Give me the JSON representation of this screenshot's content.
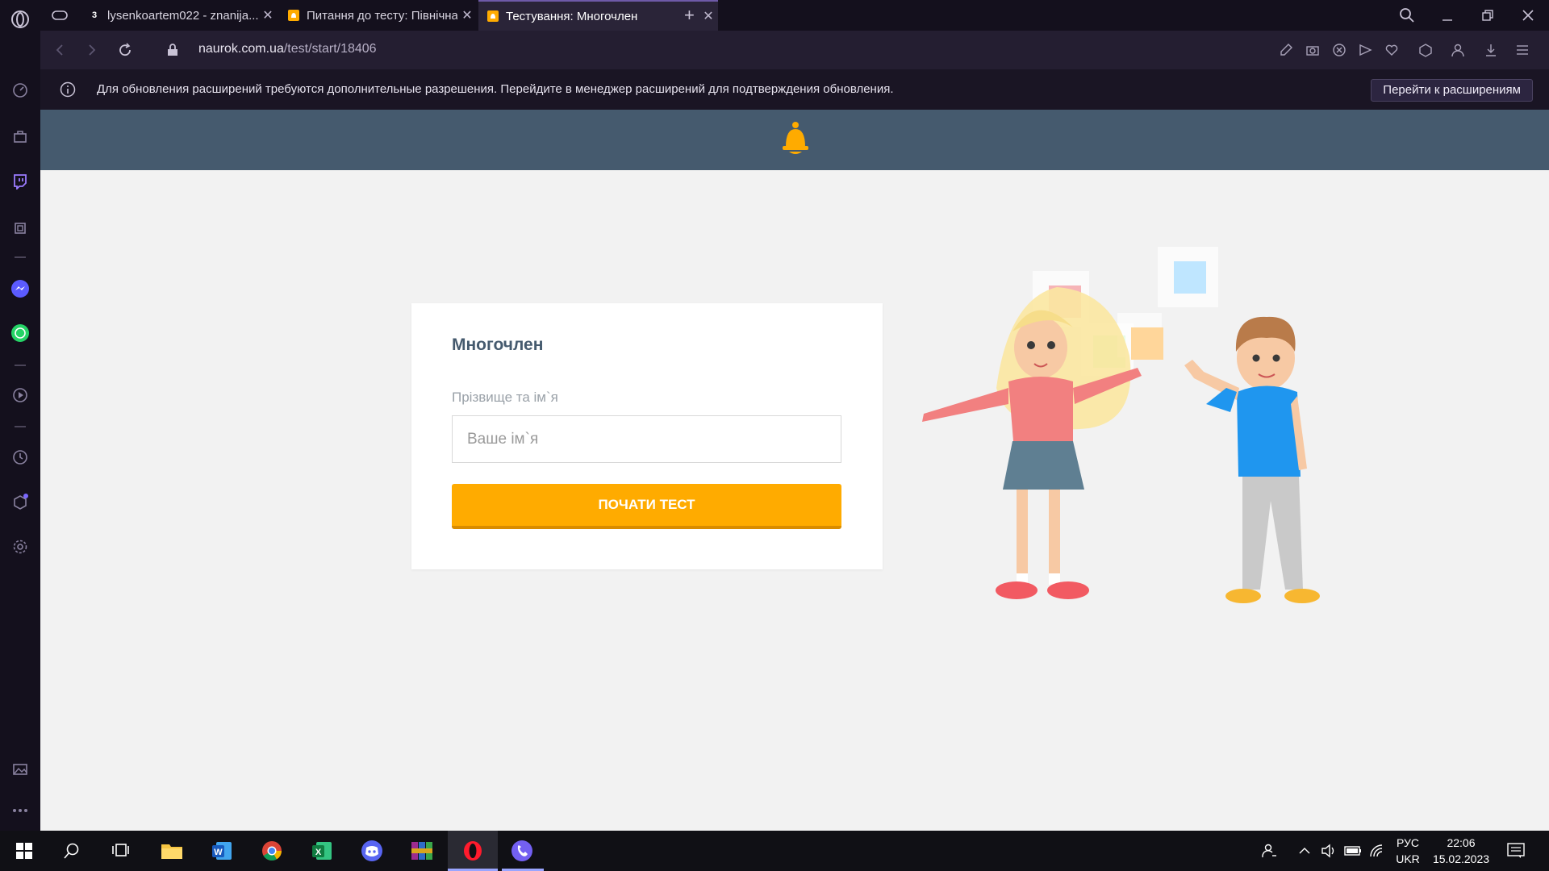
{
  "browser": {
    "tabs": [
      {
        "title": "lysenkoartem022 - znanija...",
        "favicon": "3"
      },
      {
        "title": "Питання до тесту: Північна...",
        "favicon": "bell"
      },
      {
        "title": "Тестування: Многочлен",
        "favicon": "bell"
      }
    ],
    "url_host": "naurok.com.ua",
    "url_path": "/test/start/18406"
  },
  "notification": {
    "text": "Для обновления расширений требуются дополнительные разрешения. Перейдите в менеджер расширений для подтверждения обновления.",
    "button": "Перейти к расширениям"
  },
  "test": {
    "title": "Многочлен",
    "name_label": "Прізвище та ім`я",
    "name_placeholder": "Ваше ім`я",
    "start_button": "ПОЧАТИ ТЕСТ"
  },
  "taskbar": {
    "lang_top": "РУС",
    "lang_bottom": "UKR",
    "time": "22:06",
    "date": "15.02.2023"
  },
  "colors": {
    "header": "#455a6e",
    "accent": "#ffab00",
    "browser_bg": "#14101d"
  }
}
